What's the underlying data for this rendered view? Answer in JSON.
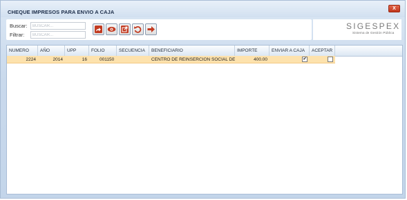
{
  "window": {
    "title": "CHEQUE IMPRESOS PARA ENVIO A CAJA",
    "close_label": "X"
  },
  "toolbar": {
    "search_label": "Buscar:",
    "search_placeholder": "BUSCAR...",
    "filter_label": "Filtrar:",
    "filter_placeholder": "BUSCAR...",
    "buttons": [
      {
        "icon": "share-icon"
      },
      {
        "icon": "eye-icon"
      },
      {
        "icon": "external-link-icon"
      },
      {
        "icon": "undo-icon"
      },
      {
        "icon": "arrow-right-icon"
      }
    ]
  },
  "logo": {
    "name": "SIGESPEX",
    "subtitle": "Sistema de Gestión Pública"
  },
  "grid": {
    "columns": [
      "NUMERO",
      "AÑO",
      "UPP",
      "FOLIO",
      "SECUENCIA",
      "BENEFICIARIO",
      "IMPORTE",
      "ENVIAR A CAJA",
      "ACEPTAR"
    ],
    "rows": [
      {
        "numero": "2224",
        "anio": "2014",
        "upp": "16",
        "folio": "001150",
        "secuencia": "",
        "beneficiario": "CENTRO DE REINSERCION SOCIAL DE M",
        "importe": "400.00",
        "enviar_a_caja": "✔",
        "aceptar": ""
      }
    ]
  },
  "colors": {
    "accent": "#c0361c",
    "selected_row": "#fde2ad",
    "window_bg": "#c9d9ec"
  }
}
